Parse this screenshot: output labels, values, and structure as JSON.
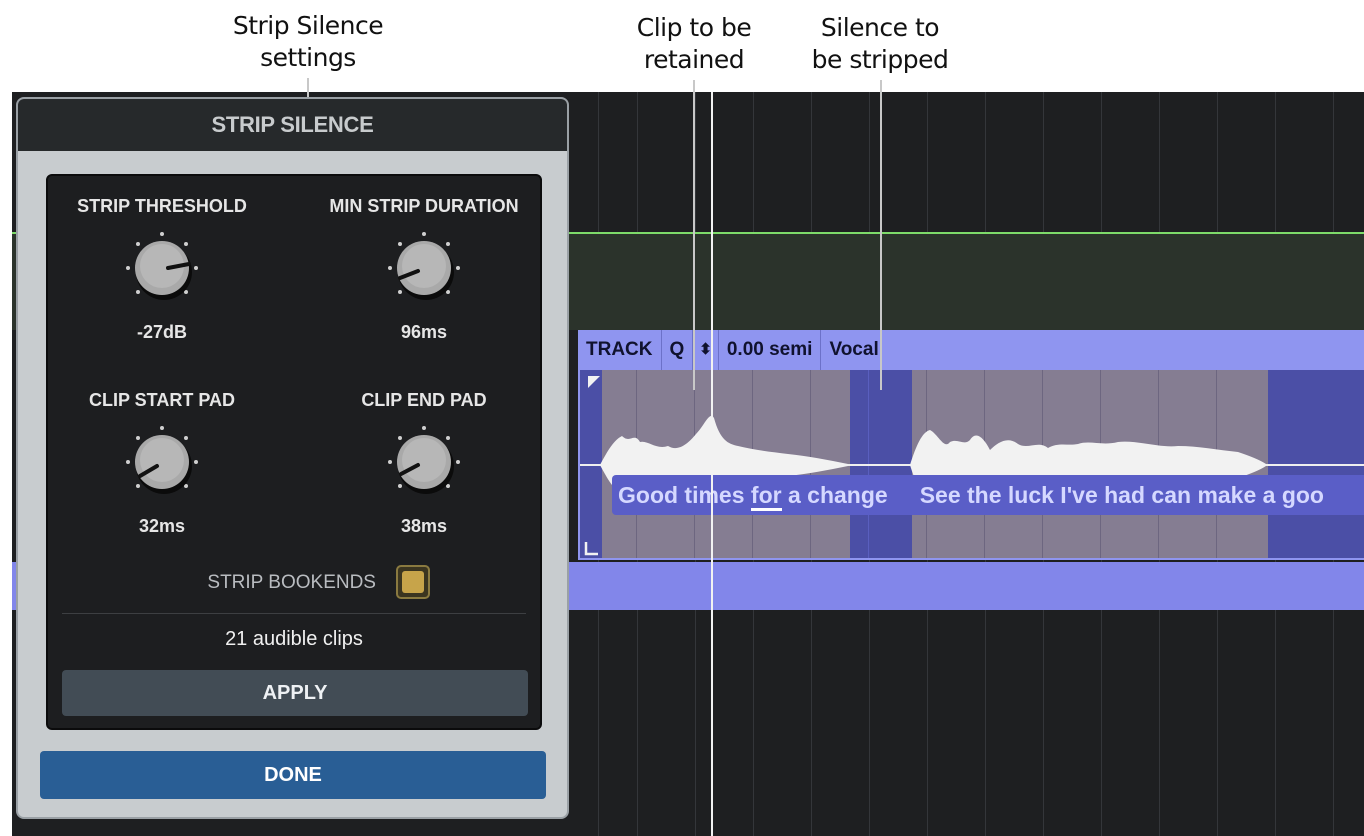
{
  "annotations": {
    "settings": {
      "line1": "Strip Silence",
      "line2": "settings"
    },
    "retained": {
      "line1": "Clip to be",
      "line2": "retained"
    },
    "stripped": {
      "line1": "Silence to",
      "line2": "be stripped"
    }
  },
  "panel": {
    "title": "STRIP SILENCE",
    "knobs": [
      {
        "label": "STRIP THRESHOLD",
        "value": "-27dB"
      },
      {
        "label": "MIN STRIP DURATION",
        "value": "96ms"
      },
      {
        "label": "CLIP START PAD",
        "value": "32ms"
      },
      {
        "label": "CLIP END PAD",
        "value": "38ms"
      }
    ],
    "bookends_label": "STRIP BOOKENDS",
    "bookends_checked": true,
    "clip_count": "21 audible clips",
    "apply_label": "APPLY",
    "done_label": "DONE"
  },
  "clip": {
    "header": {
      "track": "TRACK",
      "q": "Q",
      "pitch": "0.00 semi",
      "name": "Vocal"
    }
  },
  "lyrics": {
    "phrase1_a": "Good times ",
    "phrase1_b": "for",
    "phrase1_c": " a change",
    "phrase2": "See the luck I've had can make a goo"
  },
  "colors": {
    "accent_blue": "#295e95",
    "clip_header": "#8f95f0",
    "silence": "#4b4fa6",
    "track_green": "#7edb6a"
  }
}
